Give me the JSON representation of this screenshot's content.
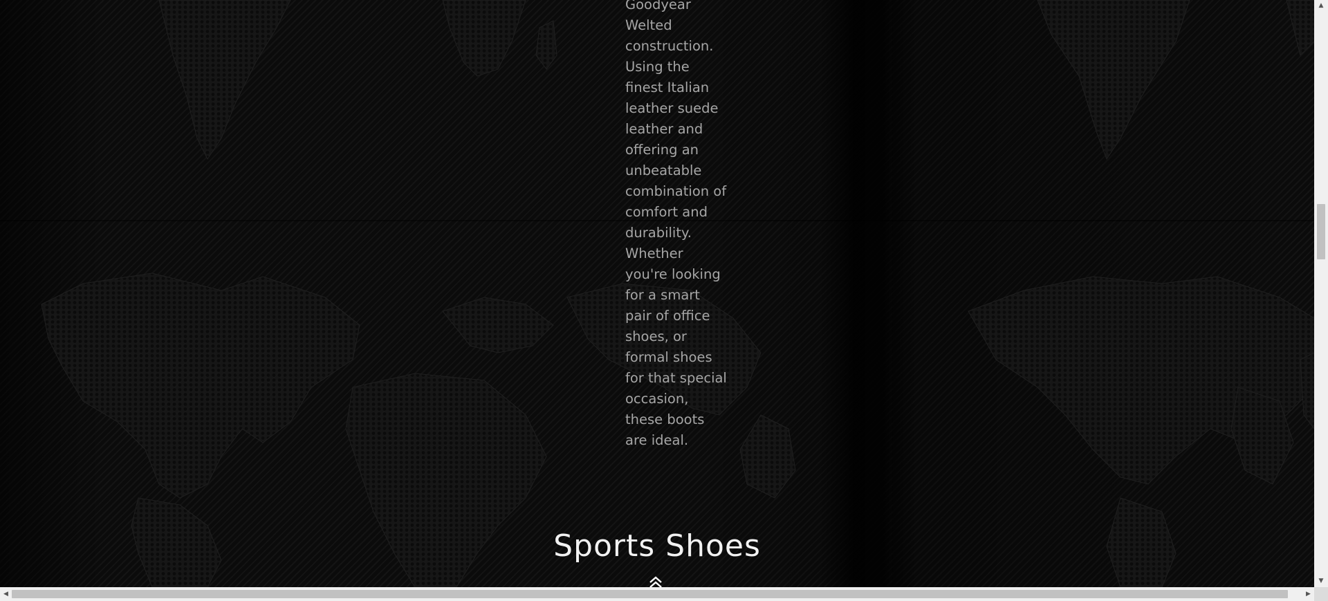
{
  "product": {
    "description": "Goodyear Welted construction. Using the finest Italian leather suede leather and offering an unbeatable combination of comfort and durability. Whether you're looking for a smart pair of office shoes, or formal shoes for that special occasion, these boots are ideal."
  },
  "section": {
    "title": "Sports Shoes"
  },
  "icons": {
    "back_to_top": "chevron-double-up-icon",
    "scroll_up": "triangle-up-icon",
    "scroll_down": "triangle-down-icon",
    "scroll_left": "triangle-left-icon",
    "scroll_right": "triangle-right-icon"
  },
  "colors": {
    "background": "#0b0b0b",
    "body_text": "#a6a6a6",
    "heading_text": "#f2f2f2",
    "map_land": "#1c1c1c"
  }
}
